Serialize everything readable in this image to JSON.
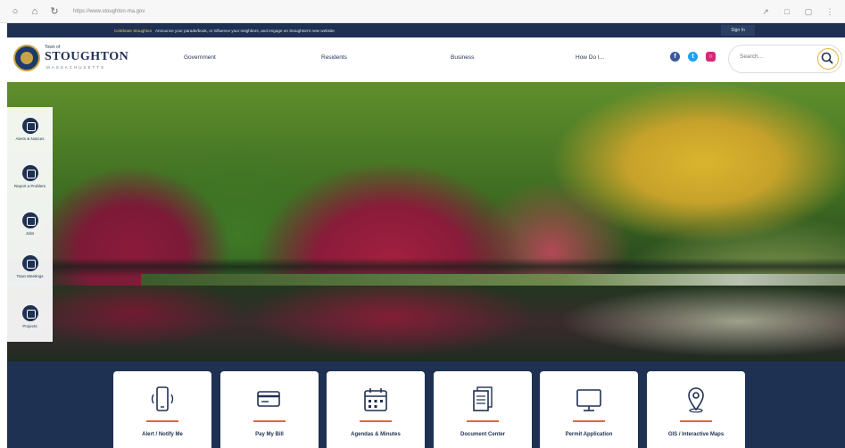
{
  "browser": {
    "url": "https://www.stoughton-ma.gov",
    "nav_icons": [
      "back-icon",
      "home-icon",
      "refresh-icon"
    ],
    "tool_icons": [
      "extensions-icon",
      "bookmark-icon",
      "profile-icon",
      "menu-icon"
    ]
  },
  "alert_bar": {
    "highlight": "Celebrate Stoughton",
    "text": "Announce your parade/book, or influence your neighbors, and engage on Stoughton's new website",
    "sign_in": "Sign In"
  },
  "header": {
    "logo": {
      "town": "Town of",
      "name": "STOUGHTON",
      "state": "MASSACHUSETTS"
    },
    "nav": [
      "Government",
      "Residents",
      "Business",
      "How Do I..."
    ],
    "social_icons": [
      "facebook-icon",
      "twitter-icon",
      "instagram-icon"
    ],
    "search_placeholder": "Search..."
  },
  "quick_links": [
    {
      "label": "Alerts & Notices",
      "icon": "bell-icon"
    },
    {
      "label": "Report a Problem",
      "icon": "report-icon"
    },
    {
      "label": "Jobs",
      "icon": "briefcase-icon"
    },
    {
      "label": "Town Meetings",
      "icon": "chat-icon"
    },
    {
      "label": "Projects",
      "icon": "project-icon"
    }
  ],
  "cards": [
    {
      "label": "Alert / Notify Me",
      "icon": "phone-alert-icon"
    },
    {
      "label": "Pay My Bill",
      "icon": "credit-card-icon"
    },
    {
      "label": "Agendas & Minutes",
      "icon": "calendar-icon"
    },
    {
      "label": "Document Center",
      "icon": "documents-icon"
    },
    {
      "label": "Permit Application",
      "icon": "monitor-icon"
    },
    {
      "label": "GIS / Interactive Maps",
      "icon": "map-pin-icon"
    }
  ],
  "colors": {
    "navy": "#1f3152",
    "gold": "#e2b33d",
    "accent_orange": "#e0653f",
    "facebook": "#3b5998",
    "twitter": "#1da1f2",
    "instagram": "#d62976"
  }
}
